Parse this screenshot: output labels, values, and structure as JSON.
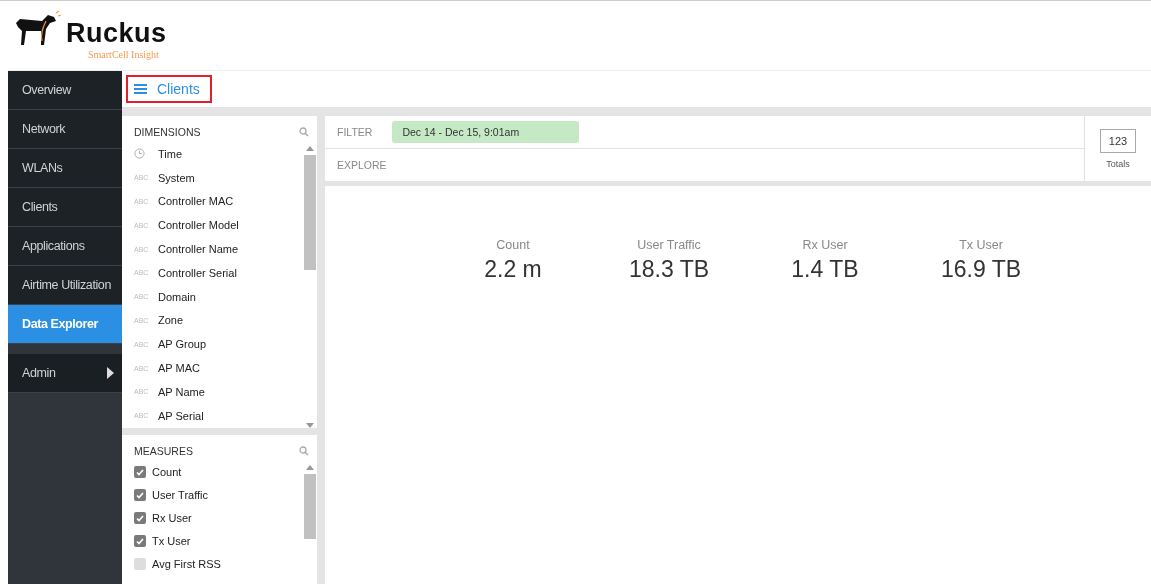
{
  "logo": {
    "name": "Ruckus",
    "subtitle": "SmartCell Insight"
  },
  "sidebar": {
    "items": [
      {
        "label": "Overview",
        "selected": false,
        "expandable": false
      },
      {
        "label": "Network",
        "selected": false,
        "expandable": false
      },
      {
        "label": "WLANs",
        "selected": false,
        "expandable": false
      },
      {
        "label": "Clients",
        "selected": false,
        "expandable": false
      },
      {
        "label": "Applications",
        "selected": false,
        "expandable": false
      },
      {
        "label": "Airtime Utilization",
        "selected": false,
        "expandable": false
      },
      {
        "label": "Data Explorer",
        "selected": true,
        "expandable": false
      },
      {
        "label": "Admin",
        "selected": false,
        "expandable": true
      }
    ]
  },
  "breadcrumb": {
    "title": "Clients"
  },
  "dimensions": {
    "title": "DIMENSIONS",
    "items": [
      {
        "kind": "time",
        "label": "Time"
      },
      {
        "kind": "text",
        "tag": "ABC",
        "label": "System"
      },
      {
        "kind": "text",
        "tag": "ABC",
        "label": "Controller MAC"
      },
      {
        "kind": "text",
        "tag": "ABC",
        "label": "Controller Model"
      },
      {
        "kind": "text",
        "tag": "ABC",
        "label": "Controller Name"
      },
      {
        "kind": "text",
        "tag": "ABC",
        "label": "Controller Serial"
      },
      {
        "kind": "text",
        "tag": "ABC",
        "label": "Domain"
      },
      {
        "kind": "text",
        "tag": "ABC",
        "label": "Zone"
      },
      {
        "kind": "text",
        "tag": "ABC",
        "label": "AP Group"
      },
      {
        "kind": "text",
        "tag": "ABC",
        "label": "AP MAC"
      },
      {
        "kind": "text",
        "tag": "ABC",
        "label": "AP Name"
      },
      {
        "kind": "text",
        "tag": "ABC",
        "label": "AP Serial"
      }
    ]
  },
  "measures": {
    "title": "MEASURES",
    "items": [
      {
        "label": "Count",
        "checked": true
      },
      {
        "label": "User Traffic",
        "checked": true
      },
      {
        "label": "Rx User",
        "checked": true
      },
      {
        "label": "Tx User",
        "checked": true
      },
      {
        "label": "Avg First RSS",
        "checked": false
      }
    ]
  },
  "filter": {
    "label": "FILTER",
    "chip": "Dec 14 - Dec 15, 9:01am"
  },
  "explore": {
    "label": "EXPLORE"
  },
  "totals": {
    "button": "123",
    "label": "Totals"
  },
  "metrics": [
    {
      "label": "Count",
      "value": "2.2 m"
    },
    {
      "label": "User Traffic",
      "value": "18.3 TB"
    },
    {
      "label": "Rx User",
      "value": "1.4 TB"
    },
    {
      "label": "Tx User",
      "value": "16.9 TB"
    }
  ]
}
